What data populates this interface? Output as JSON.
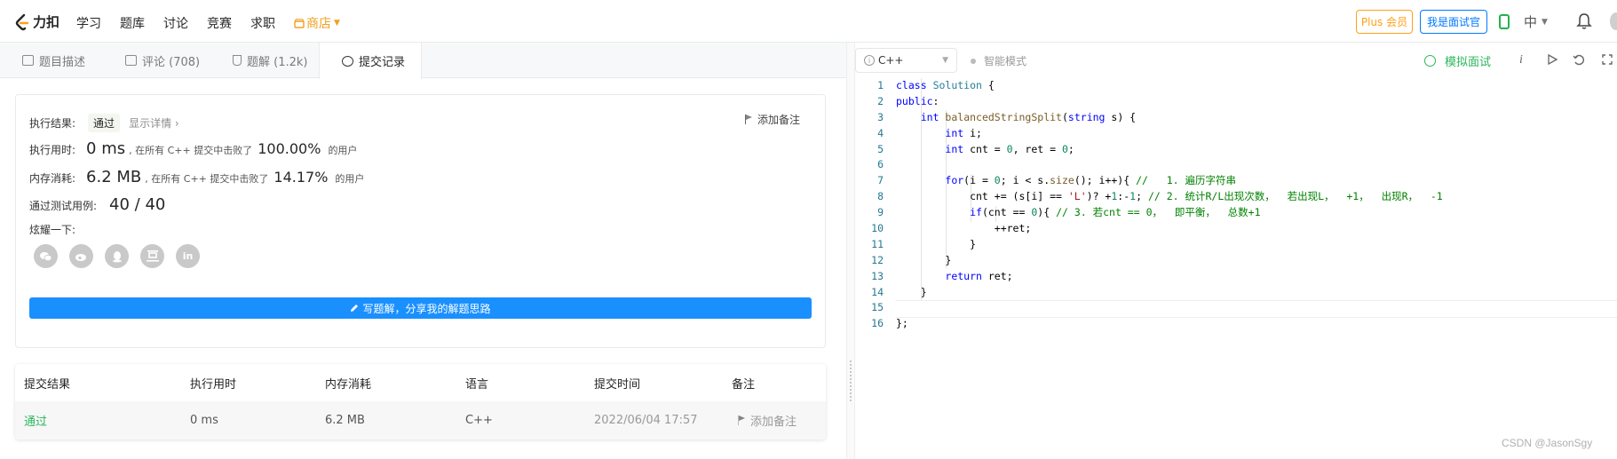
{
  "nav": {
    "logo_text": "力扣",
    "links": [
      "学习",
      "题库",
      "讨论",
      "竞赛",
      "求职"
    ],
    "shop": "商店",
    "plus_btn": "Plus 会员",
    "interviewer_btn": "我是面试官",
    "lang": "中"
  },
  "tabs": [
    {
      "label": "题目描述",
      "icon": "document-icon"
    },
    {
      "label": "评论 (708)",
      "icon": "comment-icon"
    },
    {
      "label": "题解 (1.2k)",
      "icon": "flask-icon"
    },
    {
      "label": "提交记录",
      "icon": "clock-icon"
    }
  ],
  "result": {
    "status_label": "执行结果:",
    "status_value": "通过",
    "detail_link": "显示详情",
    "add_note": "添加备注",
    "runtime_label": "执行用时:",
    "runtime_value": "0 ms",
    "runtime_prefix": ", 在所有 C++ 提交中击败了",
    "runtime_pct": "100.00%",
    "runtime_suffix": "的用户",
    "memory_label": "内存消耗:",
    "memory_value": "6.2 MB",
    "memory_prefix": ", 在所有 C++ 提交中击败了",
    "memory_pct": "14.17%",
    "memory_suffix": "的用户",
    "tests_label": "通过测试用例:",
    "tests_value": "40 / 40",
    "share_label": "炫耀一下:",
    "share_icons": [
      "wechat-icon",
      "weibo-icon",
      "qq-icon",
      "douban-icon",
      "linkedin-icon"
    ],
    "write_btn": "写题解，分享我的解题思路"
  },
  "submissions": {
    "headers": [
      "提交结果",
      "执行用时",
      "内存消耗",
      "语言",
      "提交时间",
      "备注"
    ],
    "rows": [
      {
        "result": "通过",
        "runtime": "0 ms",
        "memory": "6.2 MB",
        "lang": "C++",
        "time": "2022/06/04 17:57",
        "note": "添加备注"
      }
    ]
  },
  "editor": {
    "language": "C++",
    "smart_mode": "智能模式",
    "mock_interview": "模拟面试"
  },
  "code_lines": [
    "class Solution {",
    "public:",
    "    int balancedStringSplit(string s) {",
    "        int i;",
    "        int cnt = 0, ret = 0;",
    "",
    "        for(i = 0; i < s.size(); i++){ //   1. 遍历字符串",
    "            cnt += (s[i] == 'L')? +1:-1; // 2. 统计R/L出现次数，  若出现L，  +1，  出现R，  -1",
    "            if(cnt == 0){ // 3. 若cnt == 0，  即平衡，  总数+1",
    "                ++ret;",
    "            }",
    "        }",
    "        return ret;",
    "    }",
    "",
    "};"
  ],
  "watermark": "CSDN @JasonSgy"
}
